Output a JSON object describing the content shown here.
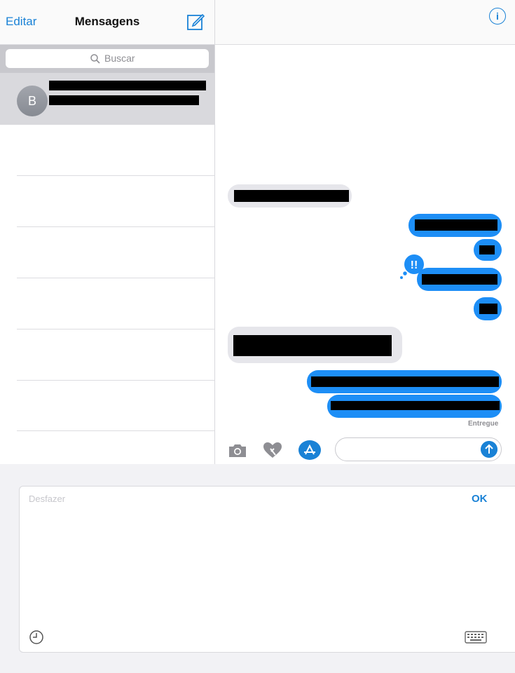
{
  "left_header": {
    "edit_label": "Editar",
    "title": "Mensagens",
    "compose_icon": "compose-icon"
  },
  "search": {
    "placeholder": "Buscar",
    "icon": "search-icon"
  },
  "conversations": [
    {
      "avatar_initial": "B",
      "name": "",
      "preview": "",
      "selected": true
    }
  ],
  "right_header": {
    "info_label": "i"
  },
  "thread": {
    "messages": [
      {
        "direction": "incoming",
        "text": ""
      },
      {
        "direction": "outgoing",
        "text": ""
      },
      {
        "direction": "outgoing",
        "text": ""
      },
      {
        "direction": "outgoing",
        "text": "",
        "reaction": "exclamation"
      },
      {
        "direction": "outgoing",
        "text": ""
      },
      {
        "direction": "incoming",
        "text": ""
      },
      {
        "direction": "outgoing",
        "text": ""
      },
      {
        "direction": "outgoing",
        "text": ""
      }
    ],
    "status": "Entregue"
  },
  "compose_bar": {
    "icons": [
      "camera-icon",
      "digital-touch-icon",
      "app-store-icon"
    ],
    "input_value": "",
    "send_icon": "send-arrow-icon"
  },
  "bottom_panel": {
    "undo_label": "Desfazer",
    "ok_label": "OK",
    "icons": [
      "clock-icon",
      "keyboard-icon"
    ]
  },
  "colors": {
    "accent": "#1a82d6",
    "outgoing_bubble": "#1d8ef6",
    "incoming_bubble": "#e6e6eb",
    "selected_row": "#d9d9dd"
  }
}
